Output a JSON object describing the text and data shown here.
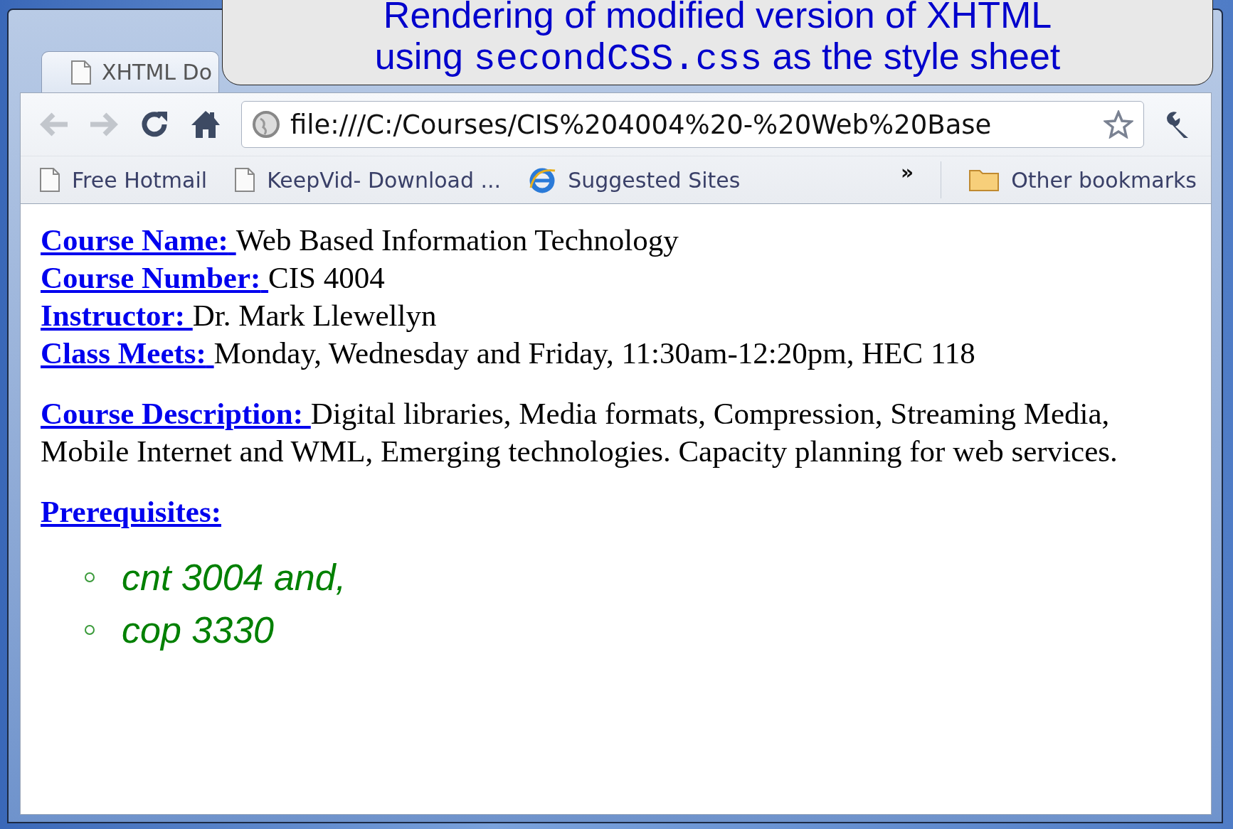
{
  "callout": {
    "lines": [
      [
        {
          "kind": "text",
          "text": "Rendering of modified version of XHTML"
        }
      ],
      [
        {
          "kind": "text",
          "text": "using "
        },
        {
          "kind": "code",
          "text": "secondCSS.css"
        },
        {
          "kind": "text",
          "text": " as the style sheet"
        }
      ]
    ]
  },
  "tab": {
    "title": "XHTML Do"
  },
  "toolbar": {
    "back_disabled": true,
    "forward_disabled": true,
    "address": "file:///C:/Courses/CIS%204004%20-%20Web%20Base"
  },
  "bookmarks": {
    "items": [
      {
        "label": "Free Hotmail",
        "kind": "page"
      },
      {
        "label": "KeepVid- Download ...",
        "kind": "page"
      },
      {
        "label": "Suggested Sites",
        "kind": "ie"
      }
    ],
    "more": "»",
    "other": "Other bookmarks"
  },
  "page": {
    "fields": [
      {
        "label": "Course Name:",
        "value": "Web Based Information Technology"
      },
      {
        "label": "Course Number:",
        "value": "CIS 4004"
      },
      {
        "label": "Instructor:",
        "value": "Dr. Mark Llewellyn"
      },
      {
        "label": "Class Meets:",
        "value": "Monday, Wednesday and Friday, 11:30am-12:20pm, HEC 118"
      }
    ],
    "description": {
      "label": "Course Description:",
      "value": "Digital libraries, Media formats, Compression, Streaming Media, Mobile Internet and WML, Emerging technologies. Capacity planning for web services."
    },
    "prerequisites": {
      "label": "Prerequisites:",
      "items": [
        "cnt 3004 and,",
        "cop 3330"
      ]
    }
  }
}
